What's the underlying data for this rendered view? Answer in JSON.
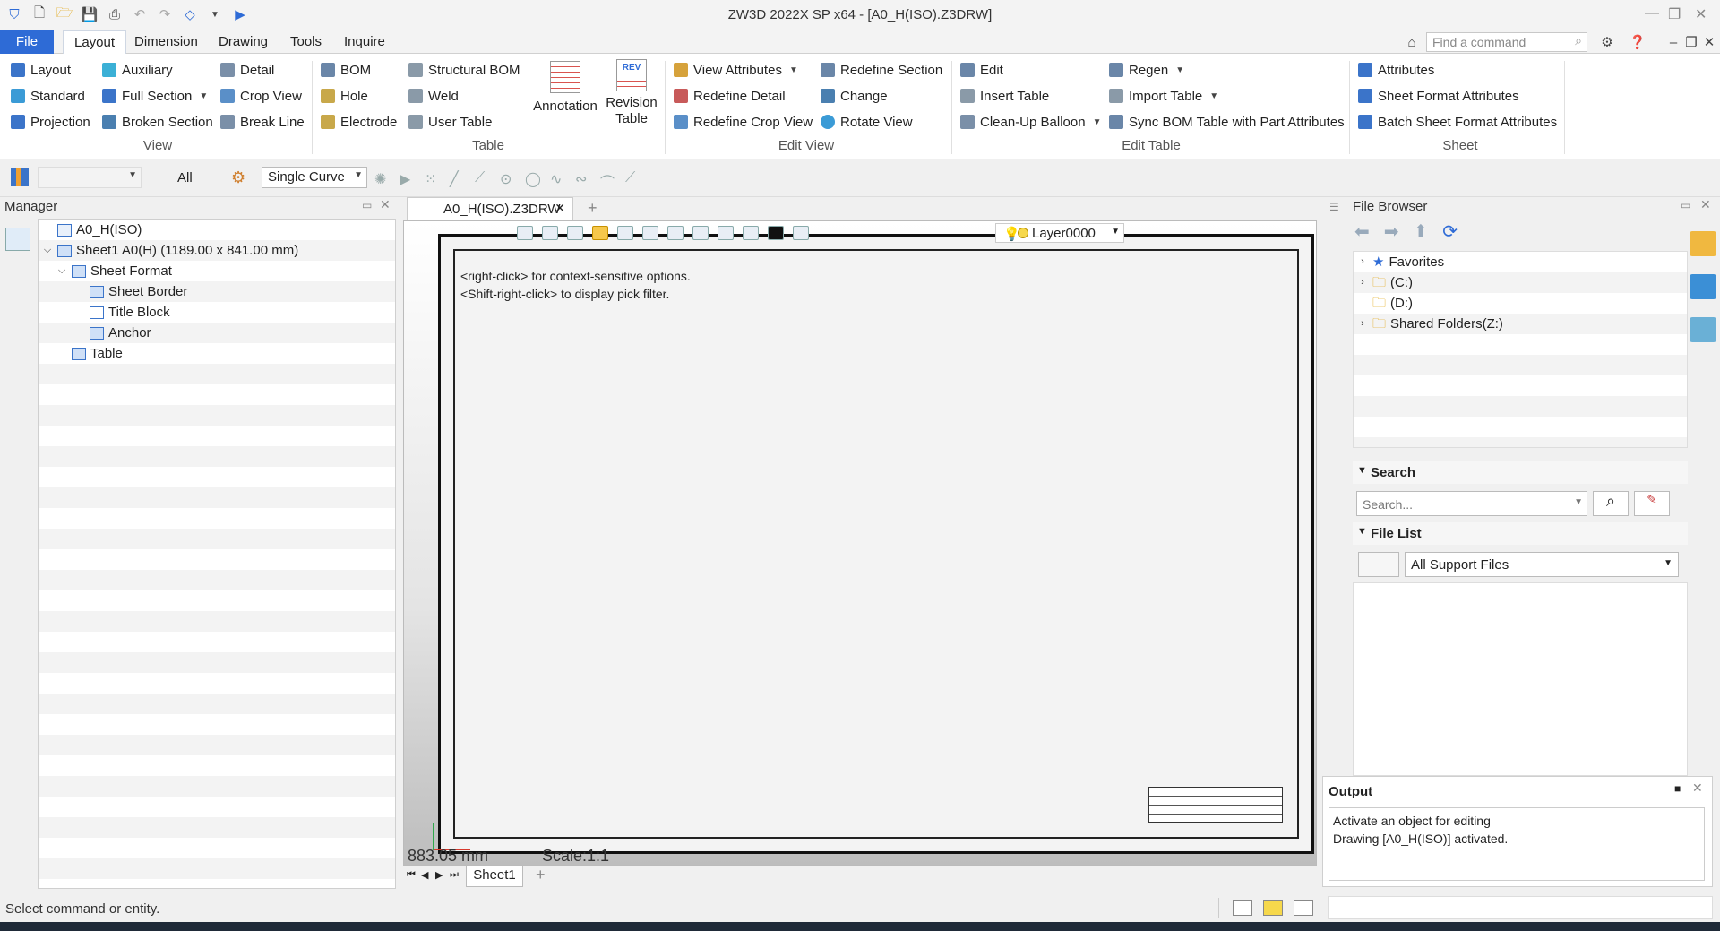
{
  "window": {
    "title": "ZW3D 2022X SP x64 - [A0_H(ISO).Z3DRW]"
  },
  "menu": {
    "file": "File",
    "tabs": [
      "Layout",
      "Dimension",
      "Drawing",
      "Tools",
      "Inquire"
    ],
    "active_tab": "Layout",
    "command_search_placeholder": "Find a command"
  },
  "ribbon": {
    "view": {
      "label": "View",
      "items": [
        "Layout",
        "Standard",
        "Projection",
        "Auxiliary",
        "Full Section",
        "Broken Section",
        "Detail",
        "Crop View",
        "Break Line"
      ]
    },
    "table": {
      "label": "Table",
      "items": [
        "BOM",
        "Hole",
        "Electrode",
        "Structural BOM",
        "Weld",
        "User Table"
      ],
      "annotation": "Annotation",
      "revision": [
        "Revision",
        "Table"
      ]
    },
    "edit_view": {
      "label": "Edit View",
      "items": [
        "View Attributes",
        "Redefine Detail",
        "Redefine Crop View",
        "Redefine Section",
        "Change",
        "Rotate View"
      ]
    },
    "edit_table": {
      "label": "Edit Table",
      "items": [
        "Edit",
        "Insert Table",
        "Clean-Up Balloon",
        "Regen",
        "Import Table",
        "Sync BOM Table with Part Attributes"
      ]
    },
    "sheet": {
      "label": "Sheet",
      "items": [
        "Attributes",
        "Sheet Format Attributes",
        "Batch Sheet Format Attributes"
      ]
    },
    "revision_icon_text": "REV"
  },
  "filterbar": {
    "filter_value": "All",
    "curve_mode": "Single Curve"
  },
  "manager": {
    "title": "Manager",
    "tree": [
      {
        "label": "A0_H(ISO)",
        "level": 0
      },
      {
        "label": "Sheet1 A0(H) (1189.00 x 841.00 mm)",
        "level": 0
      },
      {
        "label": "Sheet Format",
        "level": 1
      },
      {
        "label": "Sheet Border",
        "level": 2
      },
      {
        "label": "Title Block",
        "level": 2
      },
      {
        "label": "Anchor",
        "level": 2
      },
      {
        "label": "Table",
        "level": 1
      }
    ]
  },
  "document": {
    "tab": "A0_H(ISO).Z3DRW",
    "hint1": "<right-click> for context-sensitive options.",
    "hint2": "<Shift-right-click> to display pick filter.",
    "layer": "Layer0000",
    "coord": "883.05 mm",
    "scale": "Scale:1:1",
    "sheet_tab": "Sheet1"
  },
  "file_browser": {
    "title": "File Browser",
    "tree": [
      "Favorites",
      "(C:)",
      "(D:)",
      "Shared Folders(Z:)"
    ],
    "search_header": "Search",
    "search_placeholder": "Search...",
    "filelist_header": "File List",
    "filelist_filter": "All Support Files"
  },
  "output": {
    "title": "Output",
    "lines": [
      "Activate an object for editing",
      "Drawing [A0_H(ISO)] activated."
    ]
  },
  "status": {
    "text": "Select command or entity."
  },
  "colors": {
    "accent": "#2e6bd6",
    "icon_blue": "#3b74c9",
    "highlight": "#f6c84c"
  }
}
